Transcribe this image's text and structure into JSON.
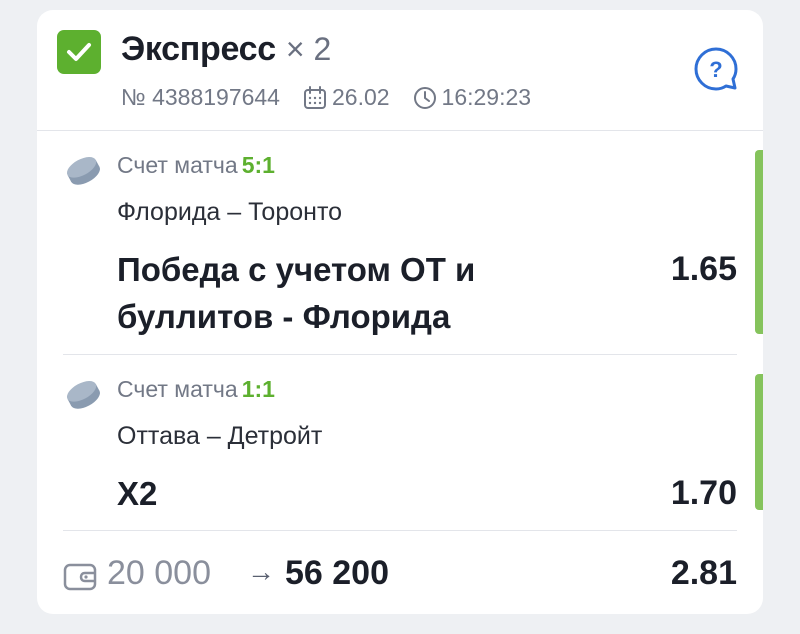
{
  "header": {
    "title": "Экспресс",
    "multiplier": "× 2",
    "bet_number": "№ 4388197644",
    "date": "26.02",
    "time": "16:29:23",
    "help_icon": "question-bubble-icon"
  },
  "bets": [
    {
      "score_label": "Счет матча",
      "score": "5:1",
      "teams": "Флорида – Торонто",
      "outcome": "Победа с учетом ОТ и буллитов - Флорида",
      "odds": "1.65"
    },
    {
      "score_label": "Счет матча",
      "score": "1:1",
      "teams": "Оттава – Детройт",
      "outcome": "Х2",
      "odds": "1.70"
    }
  ],
  "footer": {
    "stake": "20 000",
    "arrow": "→",
    "payout": "56 200",
    "total_odds": "2.81"
  },
  "colors": {
    "accent_green": "#5db02f",
    "status_bar": "#85c35c",
    "help_blue": "#2f6fd6"
  }
}
